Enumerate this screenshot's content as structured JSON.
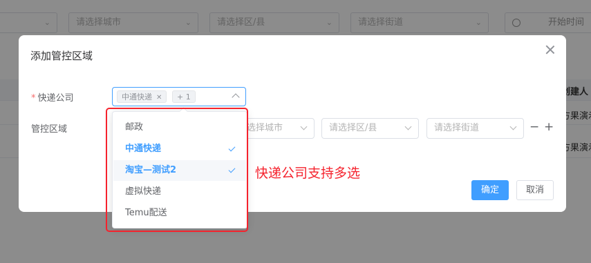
{
  "background": {
    "filters": [
      "请选择城市",
      "请选择区/县",
      "请选择街道"
    ],
    "date_placeholder": "开始时间",
    "table_header_partial": "创建人",
    "table_cells_partial": [
      "方果演示",
      "方果演示"
    ]
  },
  "dialog": {
    "title": "添加管控区域",
    "express_label": "快递公司",
    "required_mark": "*",
    "selected_tag": "中通快递",
    "collapsed_count": "+ 1",
    "area_label": "管控区域",
    "area_selects": [
      "请选择城市",
      "请选择区/县",
      "请选择街道"
    ],
    "remove_op": "−",
    "add_op": "+",
    "confirm_label": "确定",
    "cancel_label": "取消"
  },
  "dropdown": {
    "options": [
      {
        "label": "邮政",
        "selected": false
      },
      {
        "label": "中通快递",
        "selected": true
      },
      {
        "label": "淘宝—测试2",
        "selected": true
      },
      {
        "label": "虚拟快递",
        "selected": false
      },
      {
        "label": "Temu配送",
        "selected": false
      }
    ]
  },
  "annotation": "快递公司支持多选",
  "colors": {
    "primary": "#409eff",
    "annotation_red": "#f5222d"
  }
}
